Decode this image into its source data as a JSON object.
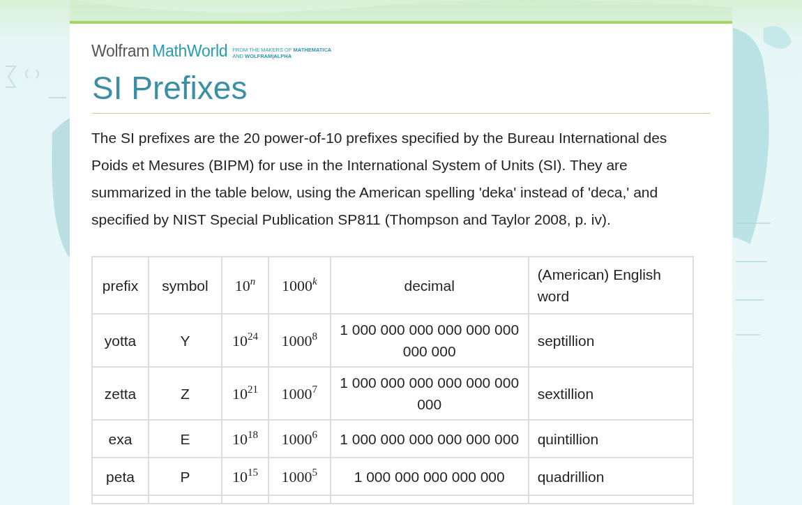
{
  "logo": {
    "brand": "Wolfram",
    "product": "MathWorld",
    "tagline": [
      "FROM THE MAKERS OF **MATHEMATICA**",
      "AND **WOLFRAM|ALPHA**"
    ]
  },
  "title": "SI Prefixes",
  "intro": "The SI prefixes are the 20 power-of-10 prefixes specified by the Bureau International des Poids et Mesures (BIPM) for use in the International System of Units (SI). They are summarized in the table below, using the American spelling 'deka' instead of 'deca,' and specified by NIST Special Publication SP811 (Thompson and Taylor 2008, p. iv).",
  "table": {
    "columns": [
      "prefix",
      "symbol",
      "10$^{n}$",
      "1000$^{k}$",
      "decimal",
      "(American) English word"
    ],
    "rows": [
      {
        "prefix": "yotta",
        "symbol": "Y",
        "power_of_10": "10$^{24}$",
        "power_of_1000": "1000$^{8}$",
        "decimal": "1 000 000 000 000 000 000 000 000",
        "english_word": "septillion"
      },
      {
        "prefix": "zetta",
        "symbol": "Z",
        "power_of_10": "10$^{21}$",
        "power_of_1000": "1000$^{7}$",
        "decimal": "1 000 000 000 000 000 000 000",
        "english_word": "sextillion"
      },
      {
        "prefix": "exa",
        "symbol": "E",
        "power_of_10": "10$^{18}$",
        "power_of_1000": "1000$^{6}$",
        "decimal": "1 000 000 000 000 000 000",
        "english_word": "quintillion"
      },
      {
        "prefix": "peta",
        "symbol": "P",
        "power_of_10": "10$^{15}$",
        "power_of_1000": "1000$^{5}$",
        "decimal": "1 000 000 000 000 000",
        "english_word": "quadrillion"
      }
    ]
  }
}
